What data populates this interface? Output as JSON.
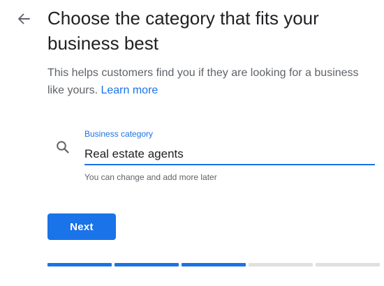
{
  "header": {
    "back_icon": "arrow-left-icon",
    "title": "Choose the category that fits your business best"
  },
  "description": {
    "text": "This helps customers find you if they are looking for a business like yours. ",
    "link_label": "Learn more"
  },
  "category_field": {
    "icon": "search-icon",
    "label": "Business category",
    "value": "Real estate agents",
    "helper": "You can change and add more later"
  },
  "actions": {
    "next_label": "Next"
  },
  "progress": {
    "total_steps": 5,
    "completed_steps": 3,
    "accent_color": "#1a73e8",
    "inactive_color": "#e0e0e0"
  },
  "colors": {
    "accent": "#1a73e8",
    "text_primary": "#202124",
    "text_secondary": "#5f6368"
  }
}
